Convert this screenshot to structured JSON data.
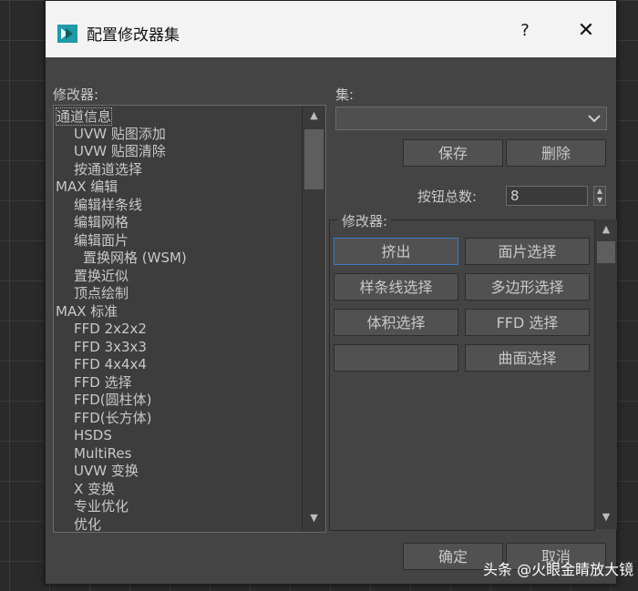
{
  "dialog": {
    "title": "配置修改器集",
    "help_label": "?",
    "close_label": "✕"
  },
  "left": {
    "label": "修改器:",
    "items": [
      {
        "text": "通道信息",
        "selected": true
      },
      {
        "text": "UVW 贴图添加"
      },
      {
        "text": "UVW 贴图清除"
      },
      {
        "text": "按通道选择"
      },
      {
        "text": "MAX 编辑"
      },
      {
        "text": "编辑样条线"
      },
      {
        "text": "编辑网格"
      },
      {
        "text": "编辑面片"
      },
      {
        "text": "置换网格 (WSM)"
      },
      {
        "text": "置换近似"
      },
      {
        "text": "顶点绘制"
      },
      {
        "text": "MAX 标准"
      },
      {
        "text": "FFD 2x2x2"
      },
      {
        "text": "FFD 3x3x3"
      },
      {
        "text": "FFD 4x4x4"
      },
      {
        "text": "FFD 选择"
      },
      {
        "text": "FFD(圆柱体)"
      },
      {
        "text": "FFD(长方体)"
      },
      {
        "text": "HSDS"
      },
      {
        "text": "MultiRes"
      },
      {
        "text": "UVW 变换"
      },
      {
        "text": "X 变换"
      },
      {
        "text": "专业优化"
      },
      {
        "text": "优化"
      }
    ]
  },
  "right": {
    "set_label": "集:",
    "set_value": "",
    "save_label": "保存",
    "delete_label": "删除",
    "count_label": "按钮总数:",
    "count_value": "8",
    "group_label": "修改器:",
    "buttons": [
      "挤出",
      "面片选择",
      "样条线选择",
      "多边形选择",
      "体积选择",
      "FFD 选择",
      "",
      "曲面选择"
    ]
  },
  "footer": {
    "ok_label": "确定",
    "cancel_label": "取消"
  },
  "watermark": "头条 @火眼金睛放大镜",
  "icons": {
    "scroll_up": "▲",
    "scroll_down": "▼",
    "dropdown": "chevron-down-icon"
  }
}
